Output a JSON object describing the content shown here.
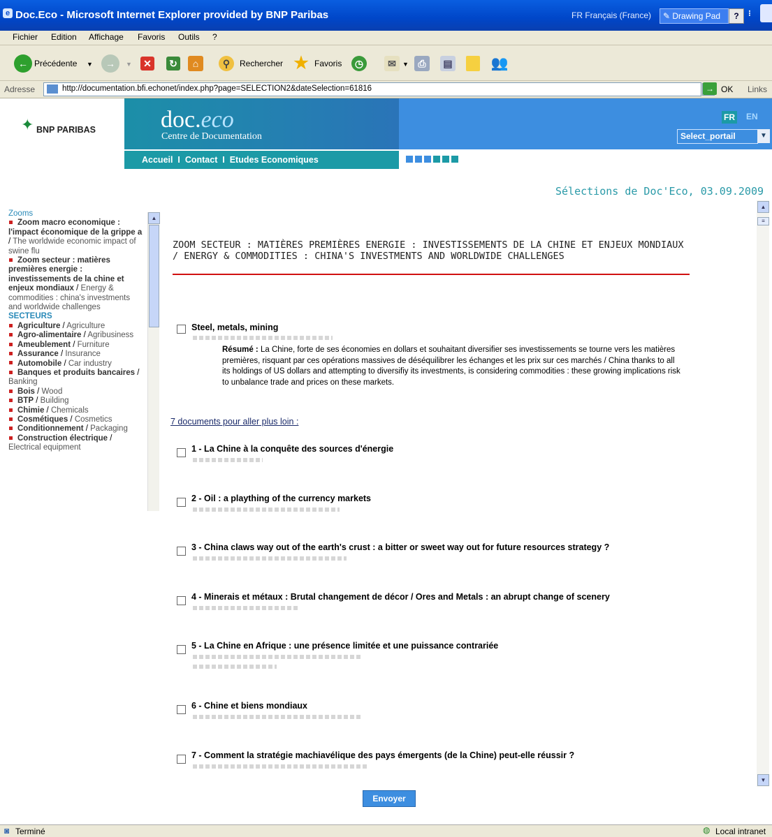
{
  "window": {
    "title": "Doc.Eco - Microsoft Internet Explorer provided by BNP Paribas",
    "language": "FR Français (France)",
    "drawing_pad": "Drawing Pad"
  },
  "menu": [
    "Fichier",
    "Edition",
    "Affichage",
    "Favoris",
    "Outils",
    "?"
  ],
  "toolbar": {
    "back": "Précédente",
    "search": "Rechercher",
    "favorites": "Favoris"
  },
  "address": {
    "label": "Adresse",
    "url": "http://documentation.bfi.echonet/index.php?page=SELECTION2&dateSelection=61816",
    "go": "OK",
    "links": "Links"
  },
  "banner": {
    "brand": "BNP PARIBAS",
    "doc_prefix": "doc.",
    "doc_suffix": "eco",
    "subtitle": "Centre de Documentation",
    "nav": "Accueil  I  Contact  I  Etudes Economiques",
    "lang_fr": "FR",
    "lang_en": "EN",
    "portal_select": "Select_portail"
  },
  "sidebar": {
    "zooms_header": "Zooms",
    "zoom1_fr": "Zoom macro economique : l'impact économique de la grippe a",
    "zoom1_en": "The worldwide economic impact of swine flu",
    "zoom2_fr": "Zoom secteur : matières premières energie : investissements de la chine et enjeux mondiaux",
    "zoom2_en": "Energy & commodities : china's investments and worldwide challenges",
    "sectors_header": "SECTEURS",
    "sectors": [
      {
        "fr": "Agriculture",
        "en": "Agriculture"
      },
      {
        "fr": "Agro-alimentaire",
        "en": "Agribusiness"
      },
      {
        "fr": "Ameublement",
        "en": "Furniture"
      },
      {
        "fr": "Assurance",
        "en": "Insurance"
      },
      {
        "fr": "Automobile",
        "en": "Car industry"
      },
      {
        "fr": "Banques et produits bancaires",
        "en": "Banking"
      },
      {
        "fr": "Bois",
        "en": "Wood"
      },
      {
        "fr": "BTP",
        "en": "Building"
      },
      {
        "fr": "Chimie",
        "en": "Chemicals"
      },
      {
        "fr": "Cosmétiques",
        "en": "Cosmetics"
      },
      {
        "fr": "Conditionnement",
        "en": "Packaging"
      },
      {
        "fr": "Construction électrique",
        "en": "Electrical equipment"
      }
    ]
  },
  "main": {
    "selection_title": "Sélections de Doc'Eco, 03.09.2009",
    "zoom_heading": "ZOOM SECTEUR : MATIÈRES PREMIÈRES ENERGIE : INVESTISSEMENTS DE LA CHINE ET ENJEUX MONDIAUX / ENERGY & COMMODITIES : CHINA'S INVESTMENTS AND WORLDWIDE CHALLENGES",
    "item_title": "Steel, metals, mining",
    "resume_label": "Résumé :",
    "resume_text": "La Chine, forte de ses économies en dollars et souhaitant diversifier ses investissements se tourne vers les matières premières, risquant par ces opérations massives de déséquilibrer les échanges et les prix sur ces marchés / China thanks to all its holdings of US dollars and attempting to diversifiy its investments, is considering commodities : these growing implications risk to unbalance trade and prices on these markets.",
    "more_docs": "7 documents pour aller plus loin :",
    "documents": [
      "1 - La Chine à la conquête des sources d'énergie",
      "2 - Oil : a plaything of the currency markets",
      "3 - China claws way out of the earth's crust : a bitter or sweet way out for future resources strategy ?",
      "4 - Minerais et métaux : Brutal changement de décor / Ores and Metals : an abrupt change of scenery",
      "5 - La Chine en Afrique : une présence limitée et une puissance contrariée",
      "6 - Chine et biens mondiaux",
      "7 - Comment la stratégie machiavélique des pays émergents (de la Chine) peut-elle réussir ?"
    ],
    "submit": "Envoyer"
  },
  "status": {
    "left": "Terminé",
    "zone": "Local intranet"
  },
  "colors": {
    "accent_teal": "#1c9aa6",
    "banner_blue": "#3d8ee0",
    "selection_title": "#2a9aa8",
    "heading_rule": "#d01010"
  }
}
